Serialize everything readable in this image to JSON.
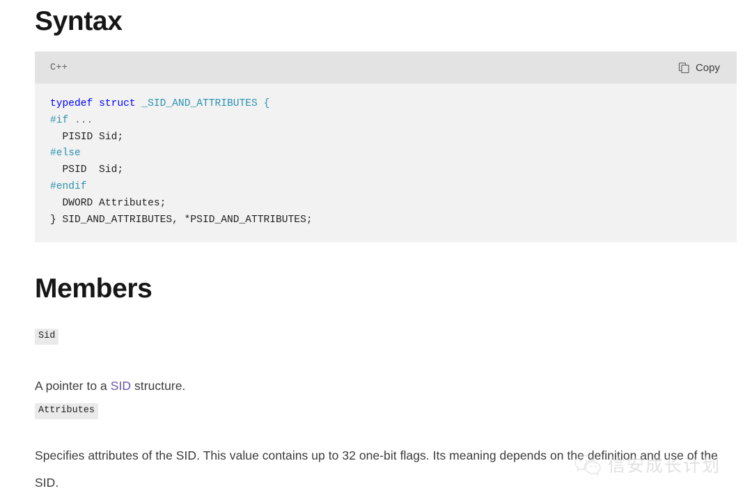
{
  "sections": {
    "syntax_heading": "Syntax",
    "members_heading": "Members"
  },
  "code_block": {
    "language_label": "C++",
    "copy_label": "Copy",
    "copy_icon": "copy-icon",
    "lines": [
      {
        "text": "typedef struct _SID_AND_ATTRIBUTES {"
      },
      {
        "text": "#if ..."
      },
      {
        "text": "  PISID Sid;"
      },
      {
        "text": "#else"
      },
      {
        "text": "  PSID  Sid;"
      },
      {
        "text": "#endif"
      },
      {
        "text": "  DWORD Attributes;"
      },
      {
        "text": "} SID_AND_ATTRIBUTES, *PSID_AND_ATTRIBUTES;"
      }
    ],
    "code_text": "typedef struct _SID_AND_ATTRIBUTES {\n#if ...\n  PISID Sid;\n#else\n  PSID  Sid;\n#endif\n  DWORD Attributes;\n} SID_AND_ATTRIBUTES, *PSID_AND_ATTRIBUTES;",
    "syntax_colors": {
      "keyword": "#0000ff",
      "type": "#2b91af",
      "preprocessor": "#2b91af",
      "plain": "#1f1f1f",
      "header_background": "#e3e3e3",
      "body_background": "#f2f2f2"
    }
  },
  "members": [
    {
      "name": "Sid",
      "description_prefix": "A pointer to a ",
      "link_text": "SID",
      "description_suffix": " structure."
    },
    {
      "name": "Attributes",
      "description": "Specifies attributes of the SID. This value contains up to 32 one-bit flags. Its meaning depends on the definition and use of the SID."
    }
  ],
  "watermark": {
    "icon": "wechat-icon",
    "text": "信安成长计划",
    "color": "#c9c9c9"
  }
}
